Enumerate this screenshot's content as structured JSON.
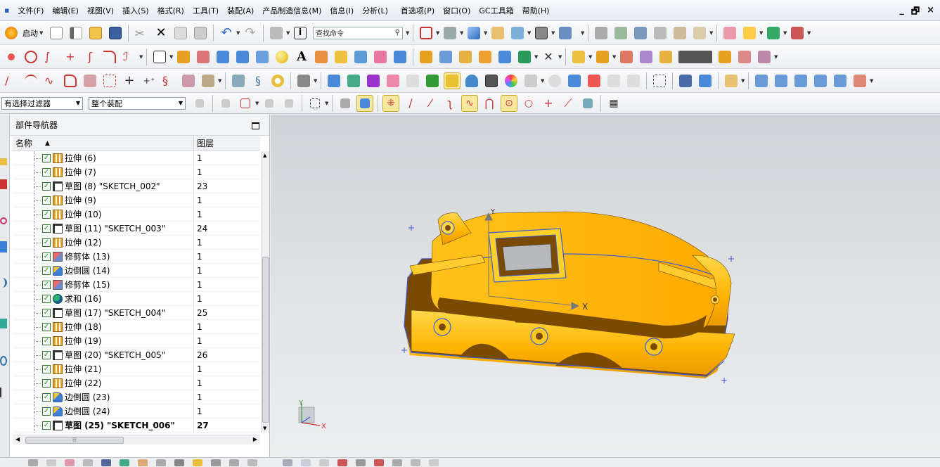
{
  "menu": [
    "文件(F)",
    "编辑(E)",
    "视图(V)",
    "插入(S)",
    "格式(R)",
    "工具(T)",
    "装配(A)",
    "产品制造信息(M)",
    "信息(I)",
    "分析(L)",
    "首选项(P)",
    "窗口(O)",
    "GC工具箱",
    "帮助(H)"
  ],
  "window_controls": [
    "_",
    "🗗",
    "×"
  ],
  "toolbar": {
    "start_label": "启动",
    "search_placeholder": "查找命令"
  },
  "filter": {
    "selection_filter": "有选择过滤器",
    "scope": "整个装配"
  },
  "navigator": {
    "title": "部件导航器",
    "col_name": "名称",
    "col_layer": "图层",
    "rows": [
      {
        "icon": "extrude-icon",
        "label": "拉伸 (6)",
        "layer": "1"
      },
      {
        "icon": "extrude-icon",
        "label": "拉伸 (7)",
        "layer": "1"
      },
      {
        "icon": "sketch-icon",
        "label": "草图 (8) \"SKETCH_002\"",
        "layer": "23"
      },
      {
        "icon": "extrude-icon",
        "label": "拉伸 (9)",
        "layer": "1"
      },
      {
        "icon": "extrude-icon",
        "label": "拉伸 (10)",
        "layer": "1"
      },
      {
        "icon": "sketch-icon",
        "label": "草图 (11) \"SKETCH_003\"",
        "layer": "24"
      },
      {
        "icon": "extrude-icon",
        "label": "拉伸 (12)",
        "layer": "1"
      },
      {
        "icon": "trim-body-icon",
        "label": "修剪体 (13)",
        "layer": "1"
      },
      {
        "icon": "edge-blend-icon",
        "label": "边倒圆 (14)",
        "layer": "1"
      },
      {
        "icon": "trim-body-icon",
        "label": "修剪体 (15)",
        "layer": "1"
      },
      {
        "icon": "unite-icon",
        "label": "求和 (16)",
        "layer": "1"
      },
      {
        "icon": "sketch-icon",
        "label": "草图 (17) \"SKETCH_004\"",
        "layer": "25"
      },
      {
        "icon": "extrude-icon",
        "label": "拉伸 (18)",
        "layer": "1"
      },
      {
        "icon": "extrude-icon",
        "label": "拉伸 (19)",
        "layer": "1"
      },
      {
        "icon": "sketch-icon",
        "label": "草图 (20) \"SKETCH_005\"",
        "layer": "26"
      },
      {
        "icon": "extrude-icon",
        "label": "拉伸 (21)",
        "layer": "1"
      },
      {
        "icon": "extrude-icon",
        "label": "拉伸 (22)",
        "layer": "1"
      },
      {
        "icon": "edge-blend-icon",
        "label": "边倒圆 (23)",
        "layer": "1"
      },
      {
        "icon": "edge-blend-icon",
        "label": "边倒圆 (24)",
        "layer": "1"
      },
      {
        "icon": "sketch-icon",
        "label": "草图 (25) \"SKETCH_006\"",
        "layer": "27",
        "bold": true
      }
    ]
  },
  "viewport": {
    "axis_x": "X",
    "axis_y": "Y",
    "triad_x": "X",
    "triad_y": "Y",
    "model_color": "#FFB800",
    "shadow_color": "#7A4A00"
  },
  "colors": {
    "extrude": "#E8A020",
    "sketch": "#333333",
    "blend": "#3C7FD4",
    "check": "#1B8A1B"
  }
}
